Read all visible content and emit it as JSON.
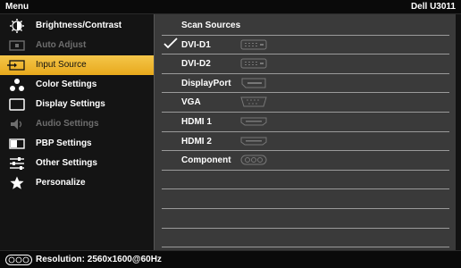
{
  "header": {
    "title": "Menu",
    "model": "Dell U3011"
  },
  "sidebar": {
    "items": [
      {
        "label": "Brightness/Contrast",
        "icon": "brightness-icon",
        "state": "normal"
      },
      {
        "label": "Auto Adjust",
        "icon": "auto-adjust-icon",
        "state": "disabled"
      },
      {
        "label": "Input Source",
        "icon": "input-source-icon",
        "state": "selected"
      },
      {
        "label": "Color Settings",
        "icon": "color-settings-icon",
        "state": "normal"
      },
      {
        "label": "Display Settings",
        "icon": "display-settings-icon",
        "state": "normal"
      },
      {
        "label": "Audio Settings",
        "icon": "audio-settings-icon",
        "state": "disabled"
      },
      {
        "label": "PBP Settings",
        "icon": "pbp-icon",
        "state": "normal"
      },
      {
        "label": "Other Settings",
        "icon": "other-settings-icon",
        "state": "normal"
      },
      {
        "label": "Personalize",
        "icon": "star-icon",
        "state": "normal"
      }
    ]
  },
  "panel": {
    "rows": [
      {
        "label": "Scan Sources",
        "checked": false,
        "port_icon": ""
      },
      {
        "label": "DVI-D1",
        "checked": true,
        "port_icon": "dvi-port-icon"
      },
      {
        "label": "DVI-D2",
        "checked": false,
        "port_icon": "dvi-port-icon"
      },
      {
        "label": "DisplayPort",
        "checked": false,
        "port_icon": "displayport-icon"
      },
      {
        "label": "VGA",
        "checked": false,
        "port_icon": "vga-port-icon"
      },
      {
        "label": "HDMI 1",
        "checked": false,
        "port_icon": "hdmi-port-icon"
      },
      {
        "label": "HDMI 2",
        "checked": false,
        "port_icon": "hdmi-port-icon"
      },
      {
        "label": "Component",
        "checked": false,
        "port_icon": "component-port-icon"
      },
      {
        "label": "",
        "checked": false,
        "port_icon": ""
      },
      {
        "label": "",
        "checked": false,
        "port_icon": ""
      },
      {
        "label": "",
        "checked": false,
        "port_icon": ""
      },
      {
        "label": "",
        "checked": false,
        "port_icon": ""
      }
    ]
  },
  "footer": {
    "resolution": "Resolution: 2560x1600@60Hz",
    "icon": "signal-connector-icon"
  },
  "colors": {
    "accent": "#f0b83a",
    "panel": "#3a3a3a",
    "sidebar": "#141414",
    "disabled": "#6e6e6e"
  }
}
